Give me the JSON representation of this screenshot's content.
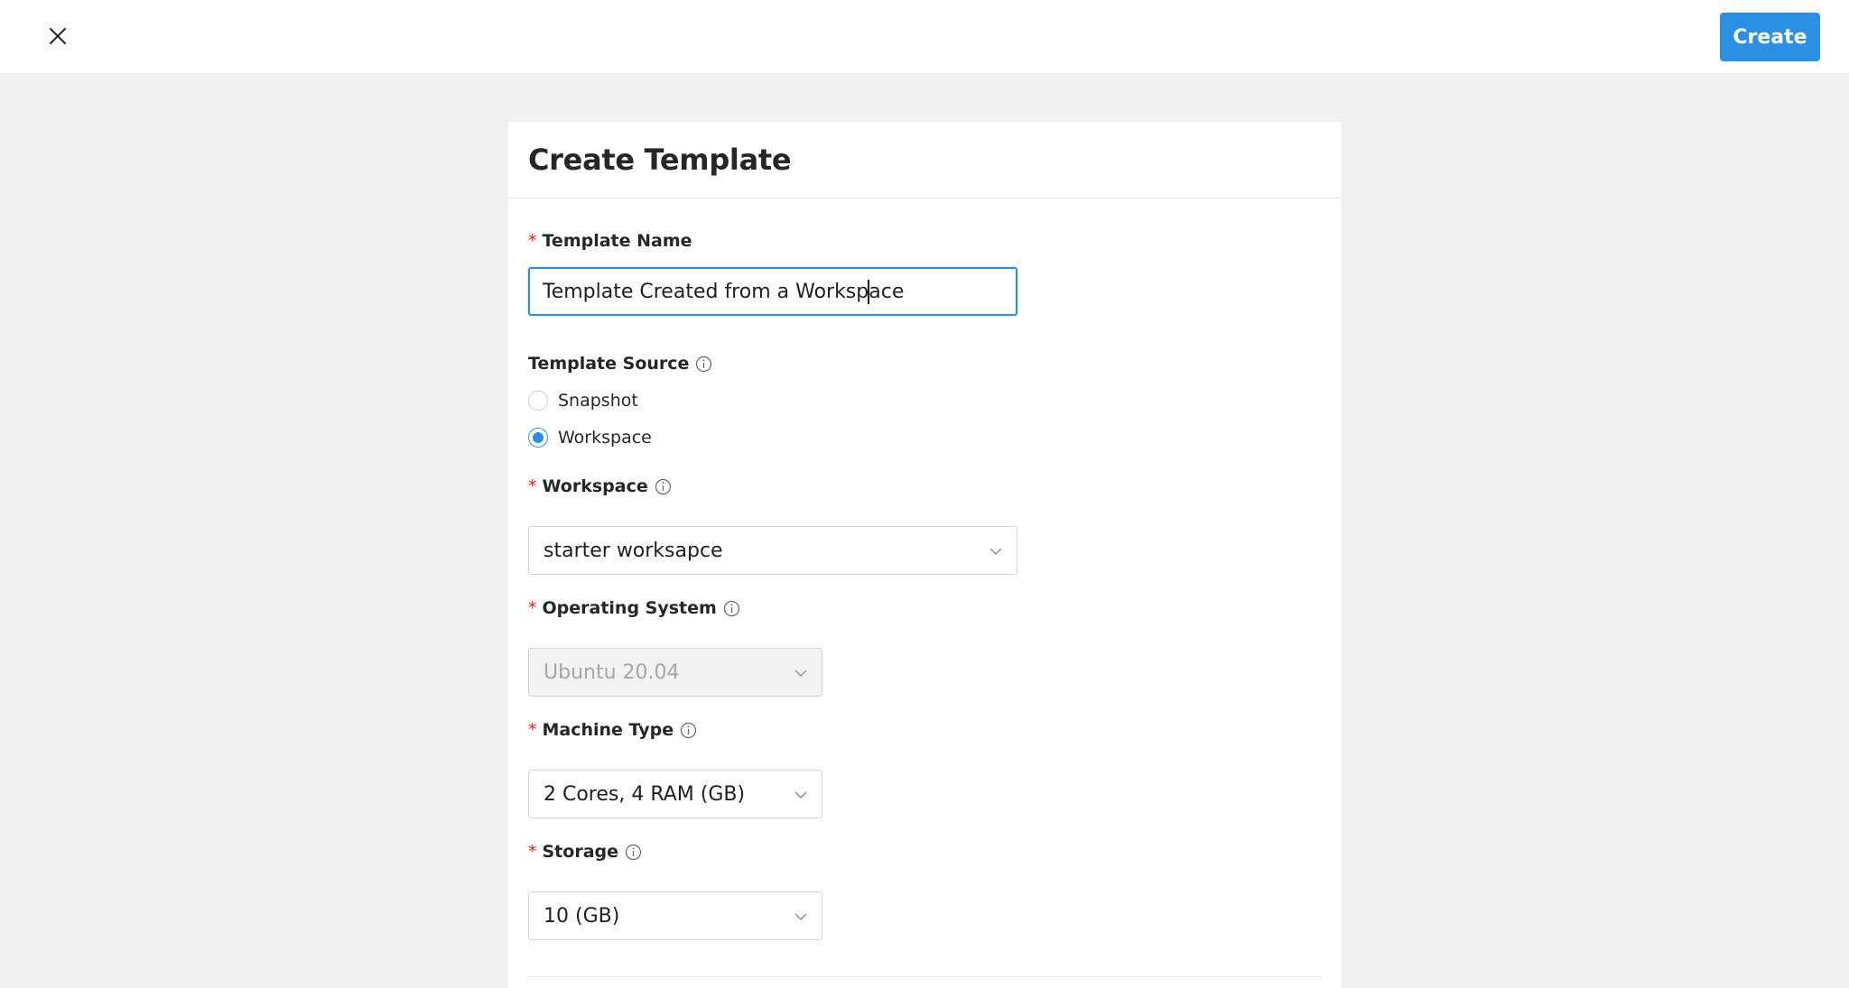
{
  "header": {
    "create_label": "Create"
  },
  "form": {
    "title": "Create Template",
    "template_name": {
      "label": "Template Name",
      "value": "Template Created from a Workspace"
    },
    "template_source": {
      "label": "Template Source",
      "options": [
        "Snapshot",
        "Workspace"
      ],
      "selected": "Workspace"
    },
    "workspace": {
      "label": "Workspace",
      "value": "starter worksapce"
    },
    "operating_system": {
      "label": "Operating System",
      "value": "Ubuntu 20.04",
      "disabled": true
    },
    "machine_type": {
      "label": "Machine Type",
      "value": "2 Cores, 4 RAM (GB)"
    },
    "storage": {
      "label": "Storage",
      "value": "10 (GB)"
    }
  },
  "icons": {
    "close": "close-icon",
    "info": "info-icon",
    "chevron": "chevron-down-icon"
  },
  "colors": {
    "accent": "#2b8fe3",
    "required": "#e02020",
    "page_bg": "#eff0f2"
  }
}
